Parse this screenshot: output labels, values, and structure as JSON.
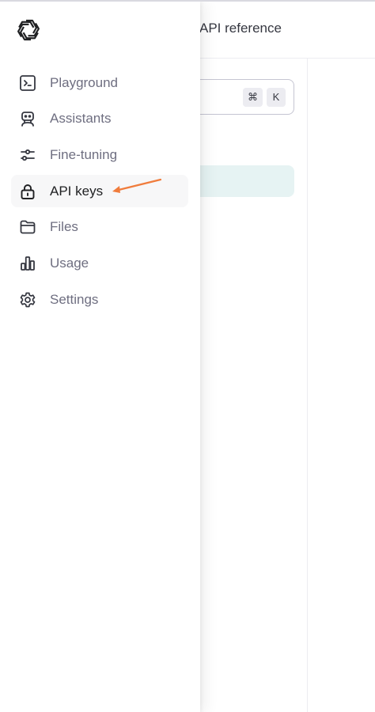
{
  "header": {
    "link_label": "API reference"
  },
  "search": {
    "shortcut_modifier": "⌘",
    "shortcut_key": "K"
  },
  "sidebar": {
    "items": [
      {
        "label": "Playground",
        "icon": "terminal-icon"
      },
      {
        "label": "Assistants",
        "icon": "robot-icon"
      },
      {
        "label": "Fine-tuning",
        "icon": "sliders-icon"
      },
      {
        "label": "API keys",
        "icon": "lock-icon",
        "active": true
      },
      {
        "label": "Files",
        "icon": "folder-icon"
      },
      {
        "label": "Usage",
        "icon": "bar-chart-icon"
      },
      {
        "label": "Settings",
        "icon": "gear-icon"
      }
    ]
  },
  "colors": {
    "annotation_arrow": "#f07c3c",
    "active_bg": "#f7f7f8",
    "highlight_bg": "#e6f3f3"
  }
}
